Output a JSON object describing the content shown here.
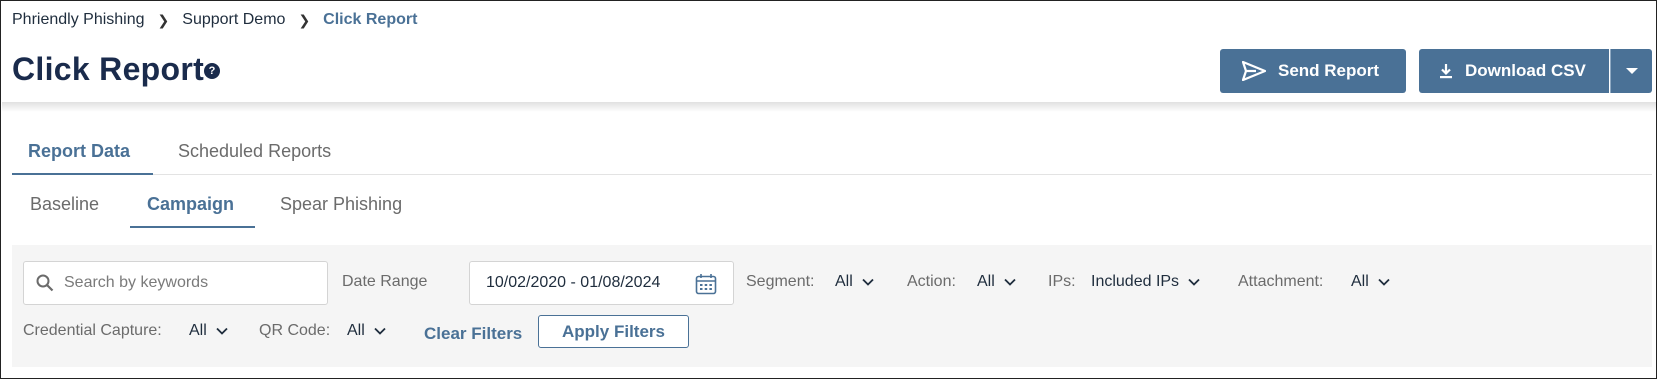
{
  "breadcrumb": {
    "items": [
      "Phriendly Phishing",
      "Support Demo"
    ],
    "current": "Click Report"
  },
  "header": {
    "title": "Click Report",
    "help_symbol": "?",
    "send_report_label": "Send Report",
    "download_csv_label": "Download CSV"
  },
  "tabs": {
    "main": [
      "Report Data",
      "Scheduled Reports"
    ],
    "active_main": "Report Data",
    "sub": [
      "Baseline",
      "Campaign",
      "Spear Phishing"
    ],
    "active_sub": "Campaign"
  },
  "filters": {
    "search_placeholder": "Search by keywords",
    "date_range_label": "Date Range",
    "date_range_value": "10/02/2020 - 01/08/2024",
    "segment_label": "Segment:",
    "segment_value": "All",
    "action_label": "Action:",
    "action_value": "All",
    "ips_label": "IPs:",
    "ips_value": "Included IPs",
    "attachment_label": "Attachment:",
    "attachment_value": "All",
    "credential_label": "Credential Capture:",
    "credential_value": "All",
    "qr_label": "QR Code:",
    "qr_value": "All",
    "clear_label": "Clear Filters",
    "apply_label": "Apply Filters"
  },
  "colors": {
    "accent": "#4a7196",
    "title": "#1a2b4c",
    "panel_bg": "#f5f5f5"
  },
  "icons": [
    "chevron-right-icon",
    "help-icon",
    "send-icon",
    "download-icon",
    "caret-down-icon",
    "search-icon",
    "calendar-icon",
    "chevron-down-icon"
  ]
}
